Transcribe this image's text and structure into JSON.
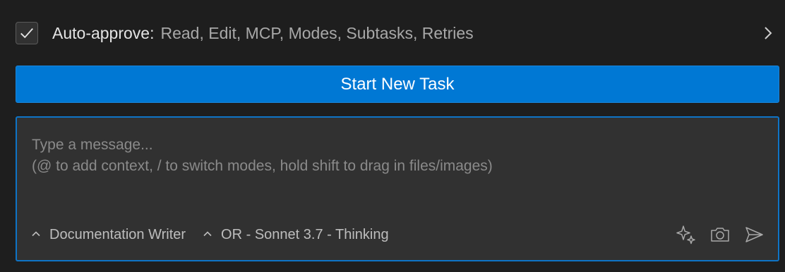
{
  "auto_approve": {
    "checked": true,
    "label": "Auto-approve:",
    "values": "Read, Edit, MCP, Modes, Subtasks, Retries",
    "expand_icon": "chevron-right-icon"
  },
  "start_button": {
    "label": "Start New Task"
  },
  "composer": {
    "placeholder_line1": "Type a message...",
    "placeholder_line2": "(@ to add context, / to switch modes, hold shift to drag in files/images)",
    "mode_selector": "Documentation Writer",
    "model_selector": "OR - Sonnet 3.7 - Thinking",
    "actions": {
      "enhance_icon": "sparkles-icon",
      "image_icon": "camera-icon",
      "send_icon": "send-icon"
    }
  },
  "colors": {
    "background": "#1e1e1e",
    "accent": "#0078d4",
    "input_background": "#313131",
    "input_border": "#0e74c6"
  }
}
